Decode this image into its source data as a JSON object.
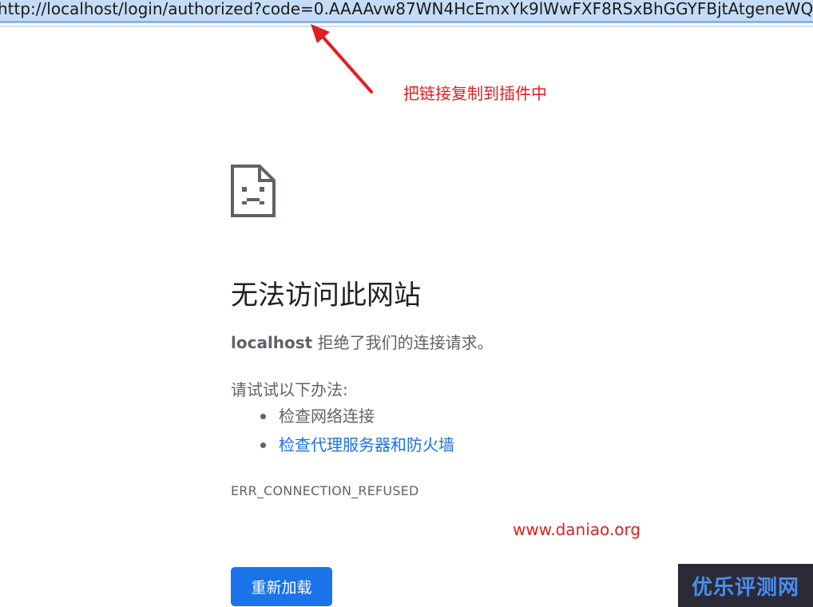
{
  "address_bar": {
    "url": "http://localhost/login/authorized?code=0.AAAAvw87WN4HcEmxYk9lWwFXF8RSxBhGGYFBjtAtgeneWQ"
  },
  "annotation": {
    "text": "把链接复制到插件中",
    "color": "#e02020"
  },
  "error_page": {
    "icon": "sad-page-icon",
    "title": "无法访问此网站",
    "host": "localhost",
    "description_suffix": " 拒绝了我们的连接请求。",
    "suggestions_heading": "请试试以下办法:",
    "suggestions": [
      {
        "label": "检查网络连接",
        "is_link": false
      },
      {
        "label": "检查代理服务器和防火墙",
        "is_link": true
      }
    ],
    "error_code": "ERR_CONNECTION_REFUSED",
    "reload_label": "重新加载",
    "accent_color": "#1a73e8"
  },
  "watermark": {
    "site": "www.daniao.org",
    "logo_text": "优乐评测网"
  }
}
